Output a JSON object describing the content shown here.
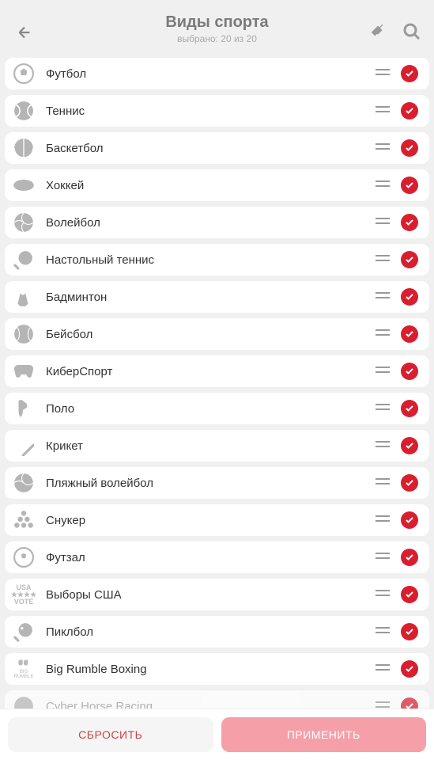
{
  "header": {
    "title": "Виды спорта",
    "subtitle": "выбрано: 20 из 20"
  },
  "sports": [
    {
      "label": "Футбол",
      "icon": "football"
    },
    {
      "label": "Теннис",
      "icon": "tennis"
    },
    {
      "label": "Баскетбол",
      "icon": "basketball"
    },
    {
      "label": "Хоккей",
      "icon": "hockey"
    },
    {
      "label": "Волейбол",
      "icon": "volleyball"
    },
    {
      "label": "Настольный теннис",
      "icon": "tabletennis"
    },
    {
      "label": "Бадминтон",
      "icon": "badminton"
    },
    {
      "label": "Бейсбол",
      "icon": "baseball"
    },
    {
      "label": "КиберСпорт",
      "icon": "esports"
    },
    {
      "label": "Поло",
      "icon": "polo"
    },
    {
      "label": "Крикет",
      "icon": "cricket"
    },
    {
      "label": "Пляжный волейбол",
      "icon": "beachvolley"
    },
    {
      "label": "Снукер",
      "icon": "snooker"
    },
    {
      "label": "Футзал",
      "icon": "futsal"
    },
    {
      "label": "Выборы США",
      "icon": "usavote"
    },
    {
      "label": "Пиклбол",
      "icon": "pickleball"
    },
    {
      "label": "Big Rumble Boxing",
      "icon": "rumble"
    },
    {
      "label": "Cyber Horse Racing",
      "icon": "horse"
    }
  ],
  "footer": {
    "reset_label": "СБРОСИТЬ",
    "apply_label": "ПРИМЕНИТЬ"
  }
}
